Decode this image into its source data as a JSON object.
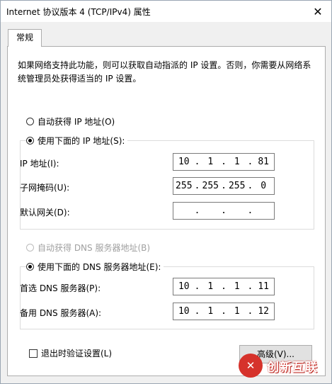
{
  "window": {
    "title": "Internet 协议版本 4 (TCP/IPv4) 属性",
    "close_glyph": "✕"
  },
  "tabs": [
    {
      "label": "常规"
    }
  ],
  "description": "如果网络支持此功能，则可以获取自动指派的 IP 设置。否则，你需要从网络系统管理员处获得适当的 IP 设置。",
  "ip_section": {
    "auto_option": "自动获得 IP 地址(O)",
    "manual_option": "使用下面的 IP 地址(S):",
    "selected": "manual",
    "fields": [
      {
        "label": "IP 地址(I):",
        "octets": [
          "10",
          "1",
          "1",
          "81"
        ]
      },
      {
        "label": "子网掩码(U):",
        "octets": [
          "255",
          "255",
          "255",
          "0"
        ]
      },
      {
        "label": "默认网关(D):",
        "octets": [
          "",
          "",
          "",
          ""
        ]
      }
    ]
  },
  "dns_section": {
    "auto_option": "自动获得 DNS 服务器地址(B)",
    "auto_disabled": true,
    "manual_option": "使用下面的 DNS 服务器地址(E):",
    "selected": "manual",
    "fields": [
      {
        "label": "首选 DNS 服务器(P):",
        "octets": [
          "10",
          "1",
          "1",
          "11"
        ]
      },
      {
        "label": "备用 DNS 服务器(A):",
        "octets": [
          "10",
          "1",
          "1",
          "12"
        ]
      }
    ]
  },
  "validate_on_exit": {
    "label": "退出时验证设置(L)",
    "checked": false
  },
  "advanced_button": "高级(V)...",
  "watermark": {
    "logo_text": "✕",
    "text": "创新互联"
  },
  "colors": {
    "watermark_red": "#d6322b",
    "border": "#adadad"
  }
}
